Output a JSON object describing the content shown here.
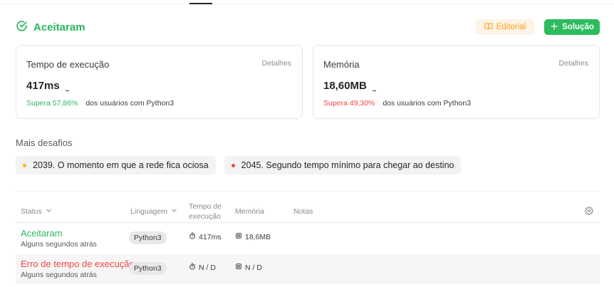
{
  "header": {
    "status": "Aceitaram",
    "editorial_label": "Editorial",
    "solution_label": "Solução"
  },
  "runtime_card": {
    "label": "Tempo de execução",
    "details": "Detalhes",
    "value": "417ms",
    "beats": "Supera 57,86%",
    "beats_suffix": "dos usuários com Python3"
  },
  "memory_card": {
    "label": "Memória",
    "details": "Detalhes",
    "value": "18,60MB",
    "beats": "Supera 49,30%",
    "beats_suffix": "dos usuários com Python3"
  },
  "more_challenges": {
    "title": "Mais desafios",
    "items": [
      {
        "label": "2039. O momento em que a rede fica ociosa",
        "difficulty_color": "#ffb800"
      },
      {
        "label": "2045. Segundo tempo mínimo para chegar ao destino",
        "difficulty_color": "#ef4743"
      }
    ]
  },
  "submissions": {
    "columns": {
      "status": "Status",
      "language": "Linguagem",
      "runtime_line1": "Tempo de",
      "runtime_line2": "execução",
      "memory": "Memória",
      "notes": "Notas"
    },
    "rows": [
      {
        "status": "Aceitaram",
        "time_ago": "Alguns segundos atrás",
        "language": "Python3",
        "runtime": "417ms",
        "memory": "18,6MB"
      },
      {
        "status": "Erro de tempo de execução",
        "time_ago": "Alguns segundos atrás",
        "language": "Python3",
        "runtime": "N / D",
        "memory": "N / D"
      }
    ]
  },
  "colors": {
    "accepted": "#2db55d",
    "error": "#ef4743",
    "editorial": "#ffa116",
    "solution_bg": "#2cbb5d"
  }
}
